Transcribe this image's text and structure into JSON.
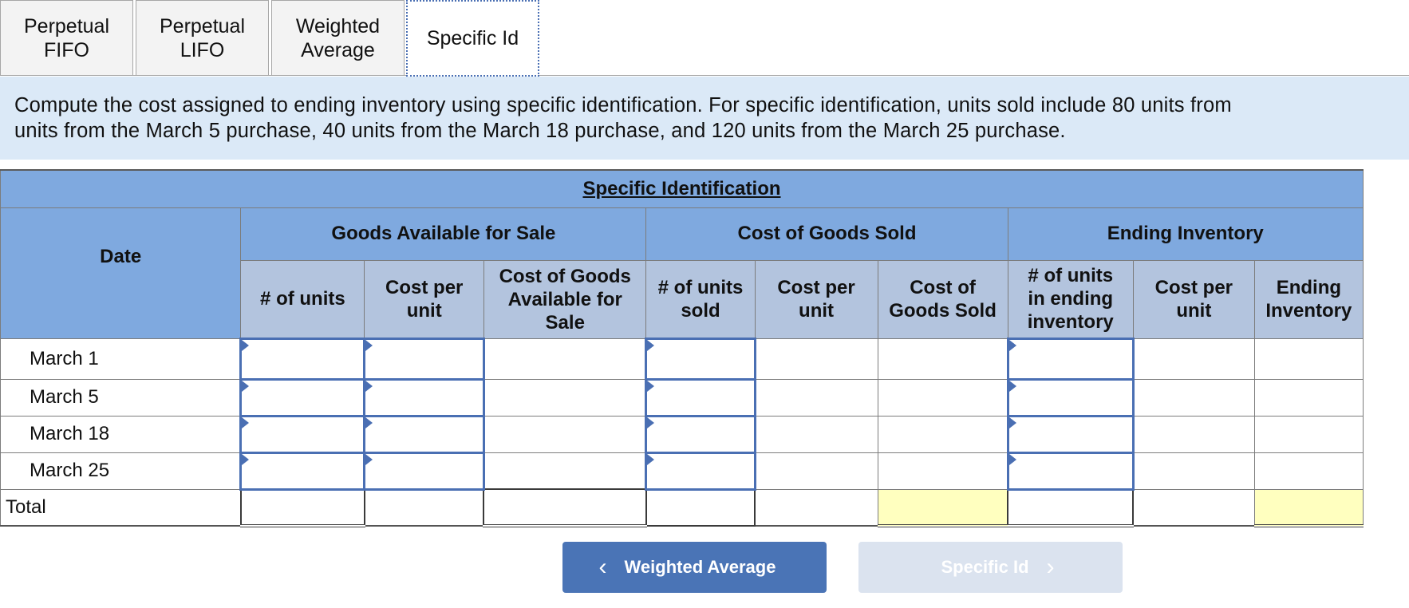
{
  "tabs": [
    {
      "label": "Perpetual FIFO"
    },
    {
      "label": "Perpetual LIFO"
    },
    {
      "label": "Weighted\nAverage"
    },
    {
      "label": "Specific Id",
      "active": true
    }
  ],
  "instruction": {
    "line1": "Compute the cost assigned to ending inventory using specific identification. For specific identification, units sold include 80 units from",
    "line2": "units from the March 5 purchase, 40 units from the March 18 purchase, and 120 units from the March 25 purchase."
  },
  "table": {
    "title": "Specific Identification",
    "date_header": "Date",
    "groups": {
      "available": "Goods Available for Sale",
      "cogs": "Cost of Goods Sold",
      "ending": "Ending Inventory"
    },
    "columns": {
      "ga_units": "# of units",
      "ga_cost": "Cost per\nunit",
      "ga_total": "Cost of Goods\nAvailable for\nSale",
      "cs_units": "# of units\nsold",
      "cs_cost": "Cost per\nunit",
      "cs_total": "Cost of\nGoods Sold",
      "ei_units": "# of units\nin ending\ninventory",
      "ei_cost": "Cost per\nunit",
      "ei_total": "Ending\nInventory"
    },
    "rows": [
      {
        "label": "March 1"
      },
      {
        "label": "March 5"
      },
      {
        "label": "March 18"
      },
      {
        "label": "March 25"
      }
    ],
    "total_label": "Total"
  },
  "nav": {
    "prev_label": "Weighted Average",
    "next_label": "Specific Id"
  },
  "colors": {
    "header_blue": "#7fa9df",
    "subheader_gray": "#b3c4de",
    "instruction_bg": "#dbe9f7",
    "input_border": "#4a6fb3",
    "total_highlight": "#ffffbf",
    "prev_button": "#4a74b6",
    "next_button_disabled": "#dbe3ef"
  }
}
